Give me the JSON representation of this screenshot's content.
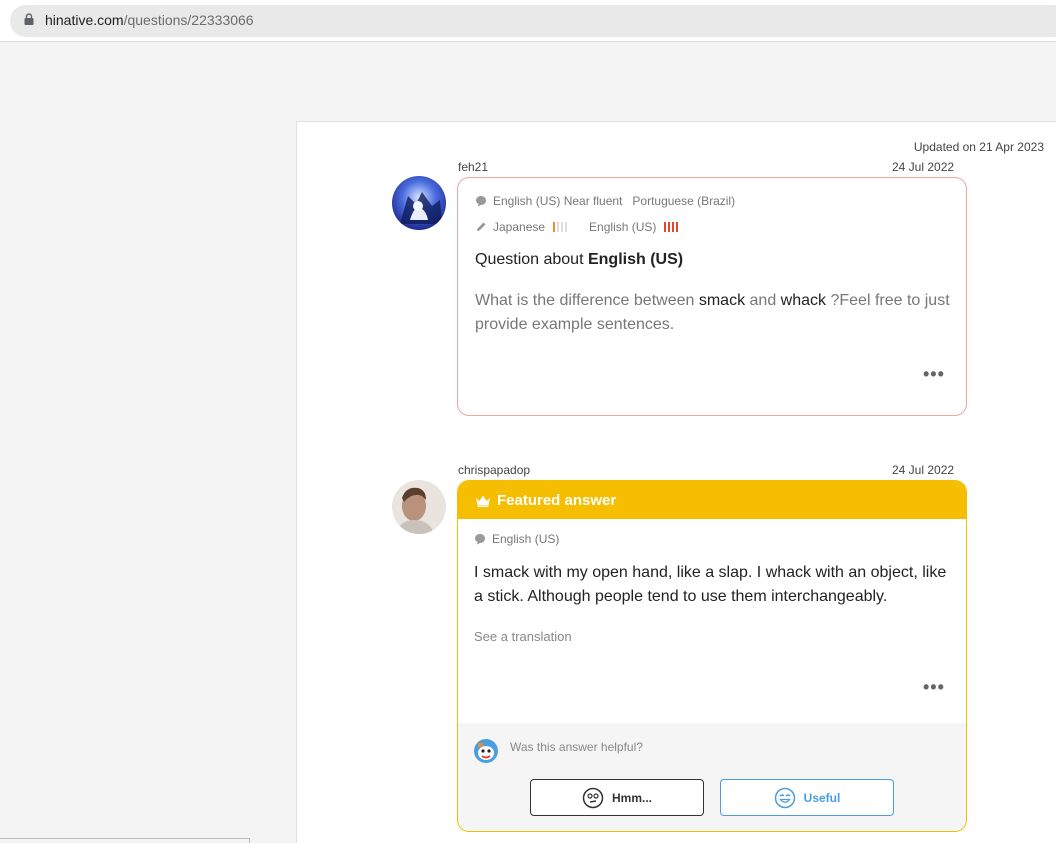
{
  "browser": {
    "url_host": "hinative.com",
    "url_path": "/questions/22333066"
  },
  "page": {
    "updated_text": "Updated on 21 Apr 2023"
  },
  "question": {
    "username": "feh21",
    "date": "24 Jul 2022",
    "native_languages": "English (US) Near fluent   Portuguese (Brazil)",
    "learning_1": "Japanese",
    "learning_2": "English (US)",
    "title_prefix": "Question about ",
    "title_language": "English (US)",
    "body_part1": "What is the difference between ",
    "body_word1": "smack",
    "body_part2": " and ",
    "body_word2": "whack",
    "body_part3": " ?Feel free to just provide example sentences.",
    "more": "•••"
  },
  "answer": {
    "username": "chrispapadop",
    "date": "24 Jul 2022",
    "featured_label": "Featured answer",
    "language": "English (US)",
    "body": "I smack with my open hand, like a slap. I whack with an object, like a stick. Although people tend to use them interchangeably.",
    "see_translation": "See a translation",
    "more": "•••",
    "helpful_question": "Was this answer helpful?",
    "hmm_label": "Hmm...",
    "useful_label": "Useful"
  },
  "colors": {
    "accent_featured": "#f5be00",
    "question_border": "#f0a79c",
    "useful_blue": "#4a9ee0",
    "level_orange": "#f08a2c",
    "level_red": "#e8442c"
  }
}
